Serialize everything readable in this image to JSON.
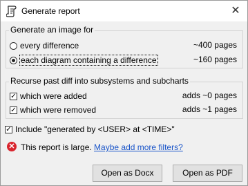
{
  "window": {
    "title": "Generate report",
    "close_glyph": "✕",
    "app_icon": "scroll-icon"
  },
  "image_group": {
    "label": "Generate an image for",
    "options": [
      {
        "label": "every difference",
        "pages": "~400 pages",
        "selected": false
      },
      {
        "label": "each diagram containing a difference",
        "pages": "~160 pages",
        "selected": true
      }
    ]
  },
  "recurse_group": {
    "label": "Recurse past diff into subsystems and subcharts",
    "options": [
      {
        "label": "which were added",
        "pages": "adds ~0 pages",
        "checked": true
      },
      {
        "label": "which were removed",
        "pages": "adds ~1 pages",
        "checked": true
      }
    ]
  },
  "include_generated": {
    "label": "Include \"generated by <USER> at <TIME>\"",
    "checked": true
  },
  "warning": {
    "text": "This report is large.",
    "link": "Maybe add more filters?",
    "icon": "error-icon",
    "glyph": "✕"
  },
  "buttons": {
    "docx": "Open as Docx",
    "pdf": "Open as PDF"
  },
  "check_glyph": "✓",
  "colors": {
    "error": "#d9242d",
    "link": "#1a55c9"
  }
}
